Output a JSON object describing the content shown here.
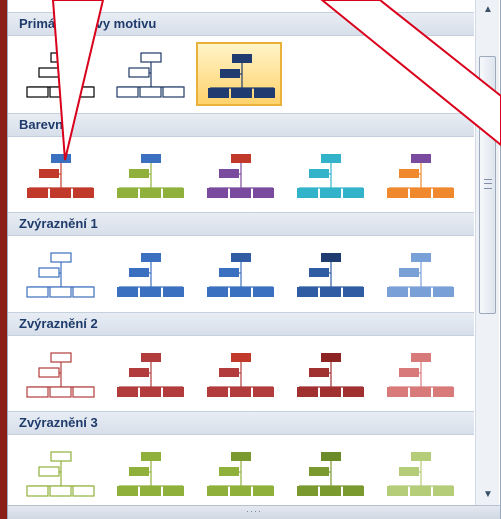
{
  "sections": [
    {
      "title": "Primární barvy motivu",
      "items": [
        {
          "name": "primary-black-outline",
          "style": "outline",
          "color": "#000000",
          "selected": false
        },
        {
          "name": "primary-navy-outline",
          "style": "outline",
          "color": "#1f3864",
          "selected": false
        },
        {
          "name": "primary-navy-filled",
          "style": "filled",
          "color": "#1f3b70",
          "accent": "#1f3b70",
          "selected": true
        }
      ]
    },
    {
      "title": "Barevný",
      "items": [
        {
          "name": "colorful-red",
          "style": "filled",
          "color": "#c0392b",
          "accent": "#3b6fbf"
        },
        {
          "name": "colorful-green",
          "style": "filled",
          "color": "#8fb03b",
          "accent": "#3b6fbf"
        },
        {
          "name": "colorful-purple",
          "style": "filled",
          "color": "#7a4a9e",
          "accent": "#c0392b"
        },
        {
          "name": "colorful-aqua",
          "style": "filled",
          "color": "#33b3c9",
          "accent": "#33b3c9"
        },
        {
          "name": "colorful-orange",
          "style": "filled",
          "color": "#f0882e",
          "accent": "#7a4a9e"
        }
      ]
    },
    {
      "title": "Zvýraznění 1",
      "items": [
        {
          "name": "accent1-outline",
          "style": "outline",
          "color": "#3b6fbf"
        },
        {
          "name": "accent1-filled-1",
          "style": "filled",
          "color": "#3b6fbf",
          "accent": "#3b6fbf"
        },
        {
          "name": "accent1-filled-2",
          "style": "filled",
          "color": "#3b6fbf",
          "accent": "#2f5ca3"
        },
        {
          "name": "accent1-filled-3",
          "style": "filled",
          "color": "#2f5ca3",
          "accent": "#1f3b70"
        },
        {
          "name": "accent1-light",
          "style": "filled",
          "color": "#7aa0d8",
          "accent": "#7aa0d8"
        }
      ]
    },
    {
      "title": "Zvýraznění 2",
      "items": [
        {
          "name": "accent2-outline",
          "style": "outline",
          "color": "#b23c3c"
        },
        {
          "name": "accent2-filled-1",
          "style": "filled",
          "color": "#b23c3c",
          "accent": "#b23c3c"
        },
        {
          "name": "accent2-filled-2",
          "style": "filled",
          "color": "#b23c3c",
          "accent": "#c0392b"
        },
        {
          "name": "accent2-filled-3",
          "style": "filled",
          "color": "#a13030",
          "accent": "#8c2424"
        },
        {
          "name": "accent2-light",
          "style": "filled",
          "color": "#d87a7a",
          "accent": "#d87a7a"
        }
      ]
    },
    {
      "title": "Zvýraznění 3",
      "items": [
        {
          "name": "accent3-outline",
          "style": "outline",
          "color": "#8fb03b"
        },
        {
          "name": "accent3-filled-1",
          "style": "filled",
          "color": "#8fb03b",
          "accent": "#8fb03b"
        },
        {
          "name": "accent3-filled-2",
          "style": "filled",
          "color": "#8fb03b",
          "accent": "#7a9a2f"
        },
        {
          "name": "accent3-filled-3",
          "style": "filled",
          "color": "#7a9a2f",
          "accent": "#6b8a28"
        },
        {
          "name": "accent3-light",
          "style": "filled",
          "color": "#b5cc78",
          "accent": "#b5cc78"
        }
      ]
    }
  ],
  "scrollbar": {
    "up_icon": "arrow-up-icon",
    "down_icon": "arrow-down-icon",
    "up_glyph": "▲",
    "down_glyph": "▼"
  },
  "footer": {
    "grip_text": "····"
  },
  "colors": {
    "background": "#8a1f17",
    "header_text": "#1f3b6b",
    "selection": "#ffd26b",
    "callout": "#d9001b"
  }
}
